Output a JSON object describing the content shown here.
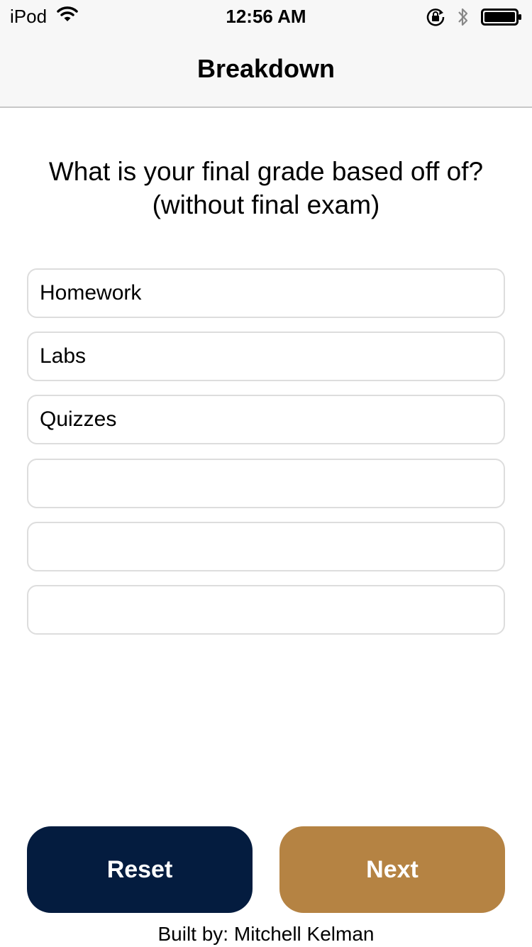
{
  "status_bar": {
    "carrier": "iPod",
    "time": "12:56 AM",
    "icons": [
      "wifi-icon",
      "rotation-lock-icon",
      "bluetooth-icon",
      "battery-icon"
    ]
  },
  "nav": {
    "title": "Breakdown"
  },
  "question": {
    "line1": "What is your final grade based off of?",
    "line2": "(without final exam)"
  },
  "fields": [
    {
      "value": "Homework"
    },
    {
      "value": "Labs"
    },
    {
      "value": "Quizzes"
    },
    {
      "value": ""
    },
    {
      "value": ""
    },
    {
      "value": ""
    }
  ],
  "buttons": {
    "reset_label": "Reset",
    "next_label": "Next"
  },
  "footer": {
    "credit": "Built by: Mitchell Kelman"
  },
  "colors": {
    "reset_bg": "#041c3f",
    "next_bg": "#b58343",
    "bar_bg": "#f7f7f7",
    "field_border": "#dddddd"
  }
}
